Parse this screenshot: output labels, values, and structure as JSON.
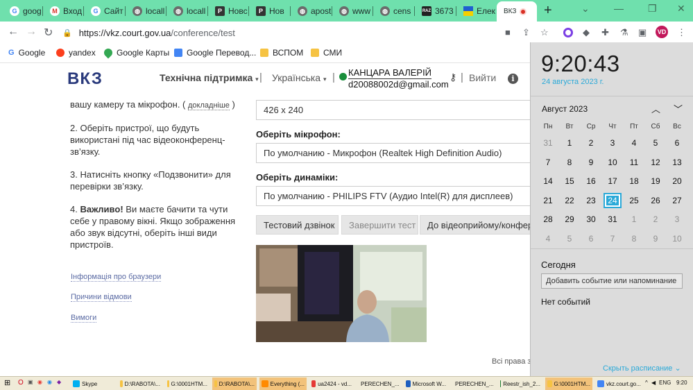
{
  "browser": {
    "tabs": [
      {
        "label": "goog",
        "icon": "google-icon"
      },
      {
        "label": "Вход",
        "icon": "gmail-icon"
      },
      {
        "label": "Сайт не",
        "icon": "google-icon"
      },
      {
        "label": "locall",
        "icon": "globe-icon"
      },
      {
        "label": "locall",
        "icon": "globe-icon"
      },
      {
        "label": "Новс",
        "icon": "pps-icon"
      },
      {
        "label": "Нов",
        "icon": "pps-icon"
      },
      {
        "label": "apost",
        "icon": "globe-icon"
      },
      {
        "label": "www",
        "icon": "globe-icon"
      },
      {
        "label": "cens",
        "icon": "globe-icon"
      },
      {
        "label": "3673",
        "icon": "raz-icon"
      },
      {
        "label": "Елек",
        "icon": "ukraine-flag-icon"
      },
      {
        "label": "ВКЗ",
        "icon": "recording-icon"
      }
    ],
    "address": {
      "host": "https://vkz.court.gov.ua",
      "path": "/conference/test"
    },
    "profile_initials": "VD",
    "bookmarks": [
      "Google",
      "yandex",
      "Google Карты",
      "Google Перевод...",
      "ВСПОМ",
      "СМИ"
    ]
  },
  "header": {
    "logo": "ВКЗ",
    "support": "Технічна підтримка",
    "language": "Українська",
    "user_name": "КАНЦАРА ВАЛЕРІЙ",
    "user_email": "d20088002d@gmail.com",
    "logout": "Вийти"
  },
  "instructions": {
    "step1_tail": "вашу камеру та мікрофон. (",
    "step1_more": "докладніше",
    "step1_close": ")",
    "step2": "2. Оберіть пристрої, що будуть використані під час відеоконференц-зв’язку.",
    "step3": "3. Натисніть кнопку «Подзвонити» для перевірки зв’язку.",
    "step4_num": "4.",
    "step4_bold": "Важливо!",
    "step4_text": " Ви маєте бачити та чути себе у правому вікні. Якщо зображення або звук відсутні, оберіть інші види пристроїв.",
    "links": [
      "Інформація про браузери",
      "Причини відмови",
      "Вимоги"
    ]
  },
  "form": {
    "resolution": "426 x 240",
    "mic_label": "Оберіть мікрофон:",
    "mic_value": "По умолчанию - Микрофон (Realtek High Definition Audio)",
    "speaker_label": "Оберіть динаміки:",
    "speaker_value": "По умолчанию - PHILIPS FTV (Аудио Intel(R) для дисплеев)",
    "btn_test_call": "Тестовий дзвінок",
    "btn_end_test": "Завершити тест",
    "btn_reception": "До відеоприйому/конференції"
  },
  "footer": "Всі права за",
  "calendar": {
    "time": "9:20:43",
    "date_long": "24 августа 2023 г.",
    "month": "Август 2023",
    "weekdays": [
      "Пн",
      "Вт",
      "Ср",
      "Чт",
      "Пт",
      "Сб",
      "Вс"
    ],
    "weeks": [
      [
        "31",
        "1",
        "2",
        "3",
        "4",
        "5",
        "6"
      ],
      [
        "7",
        "8",
        "9",
        "10",
        "11",
        "12",
        "13"
      ],
      [
        "14",
        "15",
        "16",
        "17",
        "18",
        "19",
        "20"
      ],
      [
        "21",
        "22",
        "23",
        "24",
        "25",
        "26",
        "27"
      ],
      [
        "28",
        "29",
        "30",
        "31",
        "1",
        "2",
        "3"
      ],
      [
        "4",
        "5",
        "6",
        "7",
        "8",
        "9",
        "10"
      ]
    ],
    "today_label": "Сегодня",
    "add_event": "Добавить событие или напоминание",
    "no_events": "Нет событий",
    "schedule": "Скрыть расписание"
  },
  "taskbar": {
    "items": [
      "Skype",
      "D:\\RABOTA\\...",
      "G:\\0001HTM...",
      "D:\\RABOTA\\...",
      "Everything (...",
      "ua2424 - vd...",
      "PERECHEN_...",
      "Microsoft W...",
      "PERECHEN_...",
      "Reestr_ish_2...",
      "G:\\0001HTM...",
      "vkz.court.go..."
    ],
    "lang": "ENG",
    "time": "9:20"
  },
  "colors": {
    "tabbar": "#6fe0ad",
    "accent": "#2aa9d8",
    "logo": "#2a3a7c",
    "online": "#1a8f3c"
  }
}
